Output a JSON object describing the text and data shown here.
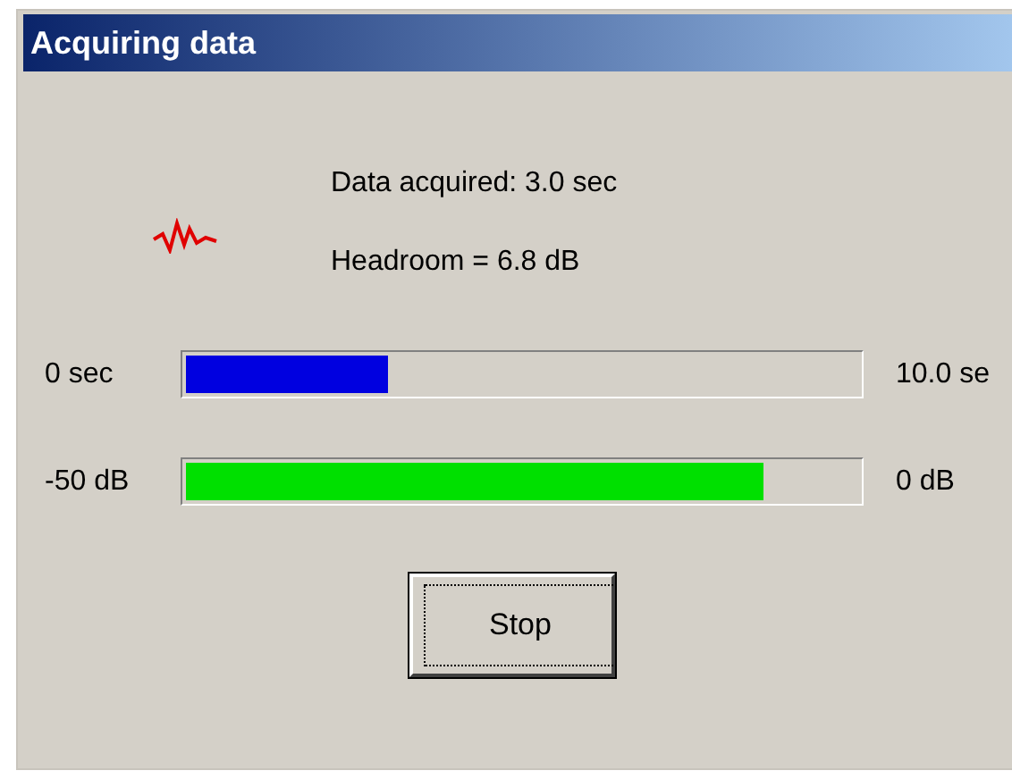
{
  "window": {
    "title": "Acquiring data"
  },
  "info": [
    "Data acquired: 3.0 sec",
    "Headroom = 6.8 dB"
  ],
  "meters": [
    {
      "min_label": "0 sec",
      "max_label": "10.0 se",
      "level": 0.3,
      "color": "#0000e0"
    },
    {
      "min_label": "-50 dB",
      "max_label": "0 dB",
      "level": 0.86,
      "color": "#00e000"
    }
  ],
  "buttons": [
    "Stop"
  ]
}
